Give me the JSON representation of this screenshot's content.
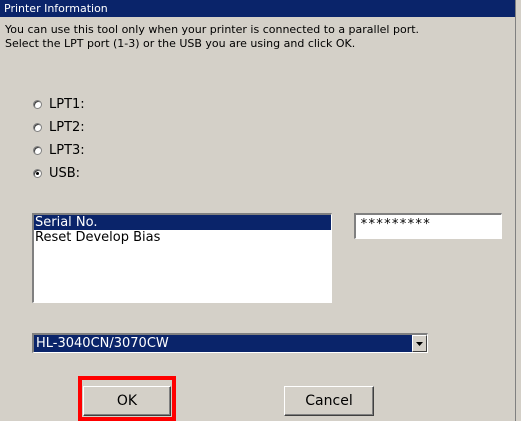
{
  "window": {
    "title": "Printer Information"
  },
  "description": {
    "line1": "You can use this tool only when your printer is connected to a parallel port.",
    "line2": "Select the LPT port (1-3) or the USB you are using and click OK."
  },
  "ports": [
    {
      "label": "LPT1:",
      "checked": false
    },
    {
      "label": "LPT2:",
      "checked": false
    },
    {
      "label": "LPT3:",
      "checked": false
    },
    {
      "label": "USB:",
      "checked": true
    }
  ],
  "functions": {
    "items": [
      {
        "label": "Serial No.",
        "selected": true
      },
      {
        "label": "Reset Develop Bias",
        "selected": false
      }
    ]
  },
  "serial_field": {
    "value": "*********"
  },
  "model_select": {
    "selected": "HL-3040CN/3070CW"
  },
  "buttons": {
    "ok": "OK",
    "cancel": "Cancel"
  },
  "colors": {
    "title_bar": "#0a246a",
    "selection": "#0a246a",
    "dialog_bg": "#d4d0c8",
    "highlight_box": "#ff0000"
  }
}
